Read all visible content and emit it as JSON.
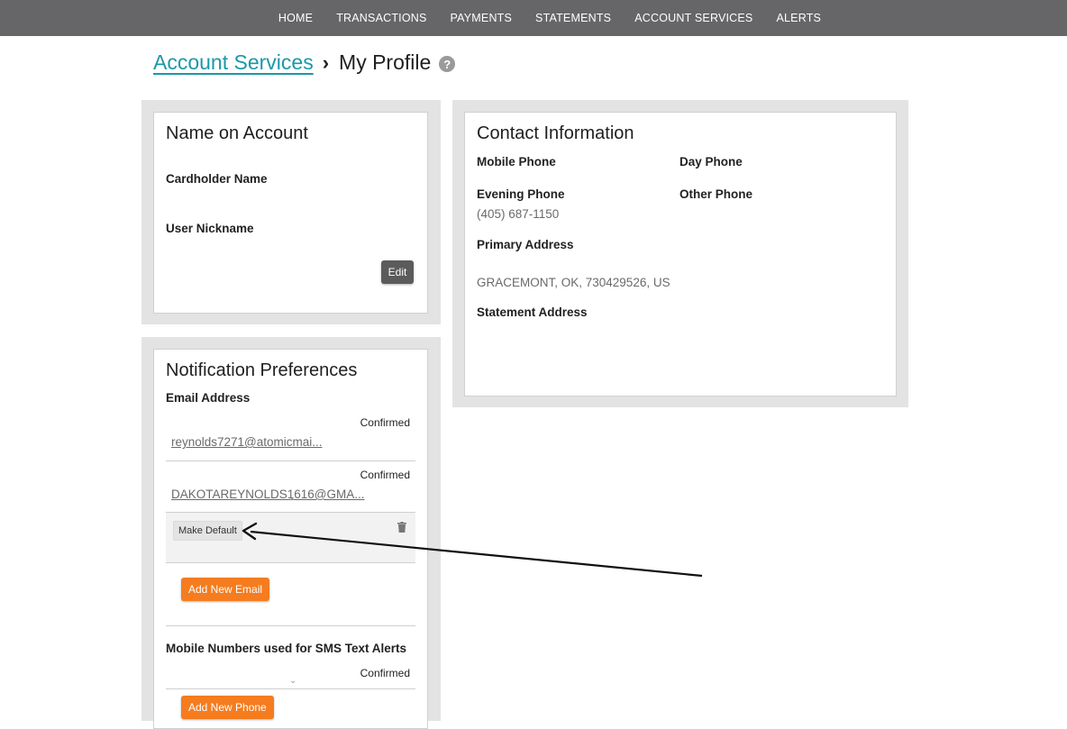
{
  "nav": {
    "items": [
      {
        "label": "HOME"
      },
      {
        "label": "TRANSACTIONS"
      },
      {
        "label": "PAYMENTS"
      },
      {
        "label": "STATEMENTS"
      },
      {
        "label": "ACCOUNT SERVICES"
      },
      {
        "label": "ALERTS"
      }
    ]
  },
  "breadcrumb": {
    "parent": "Account Services",
    "separator": "›",
    "current": "My Profile",
    "help": "?"
  },
  "name_card": {
    "title": "Name on Account",
    "cardholder_label": "Cardholder Name",
    "nickname_label": "User Nickname",
    "edit_label": "Edit"
  },
  "contact_card": {
    "title": "Contact Information",
    "mobile_label": "Mobile Phone",
    "day_label": "Day Phone",
    "evening_label": "Evening Phone",
    "evening_value": "(405) 687-1150",
    "other_label": "Other Phone",
    "primary_label": "Primary Address",
    "primary_value": "GRACEMONT, OK, 730429526, US",
    "statement_label": "Statement Address"
  },
  "notif_card": {
    "title": "Notification Preferences",
    "email_label": "Email Address",
    "emails": [
      {
        "status": "Confirmed",
        "address": "reynolds7271@atomicmai..."
      },
      {
        "status": "Confirmed",
        "address": "DAKOTAREYNOLDS1616@GMA..."
      }
    ],
    "make_default_label": "Make Default",
    "add_email_label": "Add New Email",
    "sms_label": "Mobile Numbers used for SMS Text Alerts",
    "sms_status": "Confirmed",
    "add_phone_label": "Add New Phone"
  },
  "icons": {
    "help": "question-circle-icon",
    "trash": "trash-icon",
    "chevron_up": "chevron-up-icon",
    "chevron_down": "chevron-down-icon",
    "breadcrumb_sep": "chevron-right-icon"
  },
  "colors": {
    "nav_bg": "#666668",
    "link": "#1a98a8",
    "accent_orange": "#f57c1f",
    "panel_bg": "#e3e3e3"
  }
}
